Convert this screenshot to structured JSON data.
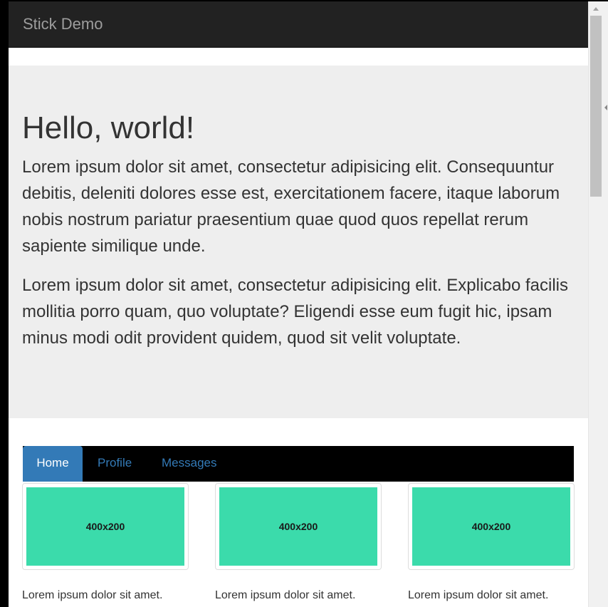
{
  "navbar": {
    "brand": "Stick Demo"
  },
  "jumbotron": {
    "title": "Hello, world!",
    "paragraphs": [
      "Lorem ipsum dolor sit amet, consectetur adipisicing elit. Consequuntur debitis, deleniti dolores esse est, exercitationem facere, itaque laborum nobis nostrum pariatur praesentium quae quod quos repellat rerum sapiente similique unde.",
      "Lorem ipsum dolor sit amet, consectetur adipisicing elit. Explicabo facilis mollitia porro quam, quo voluptate? Eligendi esse eum fugit hic, ipsam minus modi odit provident quidem, quod sit velit voluptate."
    ]
  },
  "tabs": [
    {
      "label": "Home",
      "active": true
    },
    {
      "label": "Profile",
      "active": false
    },
    {
      "label": "Messages",
      "active": false
    }
  ],
  "thumbnails": [
    {
      "placeholder": "400x200",
      "caption": "Lorem ipsum dolor sit amet."
    },
    {
      "placeholder": "400x200",
      "caption": "Lorem ipsum dolor sit amet."
    },
    {
      "placeholder": "400x200",
      "caption": "Lorem ipsum dolor sit amet."
    }
  ],
  "colors": {
    "navbar_bg": "#222222",
    "jumbotron_bg": "#eeeeee",
    "tab_active": "#337ab7",
    "tab_link": "#337ab7",
    "placeholder_fill": "#3bdbab"
  }
}
